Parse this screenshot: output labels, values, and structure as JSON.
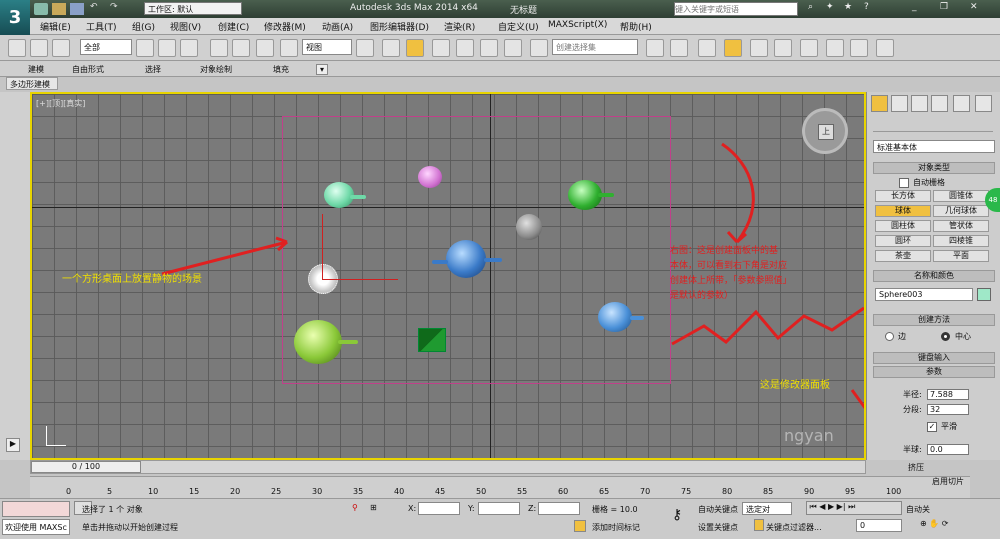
{
  "title_bar": {
    "workspace_label": "工作区: 默认",
    "app_title": "Autodesk 3ds Max  2014 x64",
    "doc_title": "无标题",
    "search_placeholder": "键入关键字或短语"
  },
  "menu": [
    "编辑(E)",
    "工具(T)",
    "组(G)",
    "视图(V)",
    "创建(C)",
    "修改器(M)",
    "动画(A)",
    "图形编辑器(D)",
    "渲染(R)",
    "自定义(U)",
    "MAXScript(X)",
    "帮助(H)"
  ],
  "toolbar": {
    "selection_filter": "全部",
    "coord_system": "视图",
    "named_selection_placeholder": "创建选择集"
  },
  "ribbon_tabs": [
    "建模",
    "自由形式",
    "选择",
    "对象绘制",
    "填充"
  ],
  "ribbon_subtab": "多边形建模",
  "viewport": {
    "label": "[+][顶][真实]",
    "viewcube_face": "上",
    "annotations": {
      "scene_note": "一个方形桌面上放置静物的场景",
      "red_note_lines": [
        "右图：这是创建面板中的基",
        "本体，可以看到右下角是对应",
        "创建体上所带，「参数参照值」",
        "是默认的参数）"
      ],
      "modifier_note": "这是修改器面板",
      "watermark": "ngyan"
    },
    "colors": {
      "accent_border": "#e8d400",
      "bbox": "#c0408a",
      "annotation_red": "#e02020",
      "annotation_yellow": "#f0e000"
    }
  },
  "command_panel": {
    "category_dropdown": "标准基本体",
    "object_type": {
      "title": "对象类型",
      "auto_grid": "自动栅格",
      "buttons": [
        "长方体",
        "圆锥体",
        "球体",
        "几何球体",
        "圆柱体",
        "管状体",
        "圆环",
        "四棱锥",
        "茶壶",
        "平面"
      ]
    },
    "name_color": {
      "title": "名称和颜色",
      "name": "Sphere003"
    },
    "creation_method": {
      "title": "创建方法",
      "opt1": "边",
      "opt2": "中心"
    },
    "keyboard_entry": "键盘输入",
    "parameters": {
      "title": "参数",
      "radius_label": "半径:",
      "radius": "7.588",
      "segments_label": "分段:",
      "segments": "32",
      "smooth_label": "平滑",
      "hemi_label": "半球:",
      "hemi": "0.0",
      "squash_label": "挤压",
      "slice_label": "启用切片"
    },
    "badge": "48"
  },
  "timeline": {
    "frame": "0 / 100",
    "ticks": [
      "0",
      "5",
      "10",
      "15",
      "20",
      "25",
      "30",
      "35",
      "40",
      "45",
      "50",
      "55",
      "60",
      "65",
      "70",
      "75",
      "80",
      "85",
      "90",
      "95",
      "100"
    ]
  },
  "status": {
    "welcome": "欢迎使用 MAXSc",
    "selected": "选择了 1 个 对象",
    "hint": "单击并拖动以开始创建过程",
    "x_label": "X:",
    "y_label": "Y:",
    "z_label": "Z:",
    "grid": "栅格 = 10.0",
    "add_time_tag": "添加时间标记",
    "auto_key": "自动关键点",
    "set_key": "设置关键点",
    "selected_obj": "选定对",
    "key_filters": "关键点过滤器...",
    "frame_value": "0",
    "auto_label2": "自动关"
  }
}
